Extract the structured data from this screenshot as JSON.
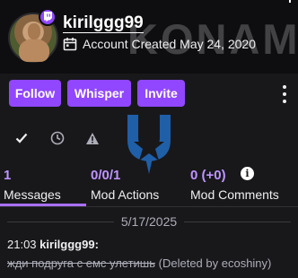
{
  "header": {
    "watermark": "KONAMI",
    "username": "kirilggg99",
    "account_created": "Account Created May 24, 2020",
    "icons": {
      "platform": "twitch-badge-icon",
      "calendar": "calendar-icon"
    }
  },
  "actions": {
    "follow_label": "Follow",
    "whisper_label": "Whisper",
    "invite_label": "Invite",
    "menu_icon": "kebab-menu-icon"
  },
  "filter_tabs": [
    {
      "icon": "checkmark-icon"
    },
    {
      "icon": "clock-icon"
    },
    {
      "icon": "warning-icon"
    }
  ],
  "stats": {
    "messages": {
      "value": "1",
      "label": "Messages"
    },
    "mod_actions": {
      "value": "0/0/1",
      "label": "Mod Actions"
    },
    "mod_comments": {
      "value": "0 (+0)",
      "label": "Mod Comments"
    },
    "info_icon": "i"
  },
  "log": {
    "date": "5/17/2025",
    "messages": [
      {
        "time": "21:03",
        "user": "kirilggg99:",
        "text": "жди подруга с емс улетишь",
        "note": "(Deleted by ecoshiny)"
      }
    ]
  },
  "colors": {
    "accent": "#9147ff",
    "accent_text": "#bf94ff",
    "background": "#18181b",
    "header_background": "#0e0e10"
  }
}
